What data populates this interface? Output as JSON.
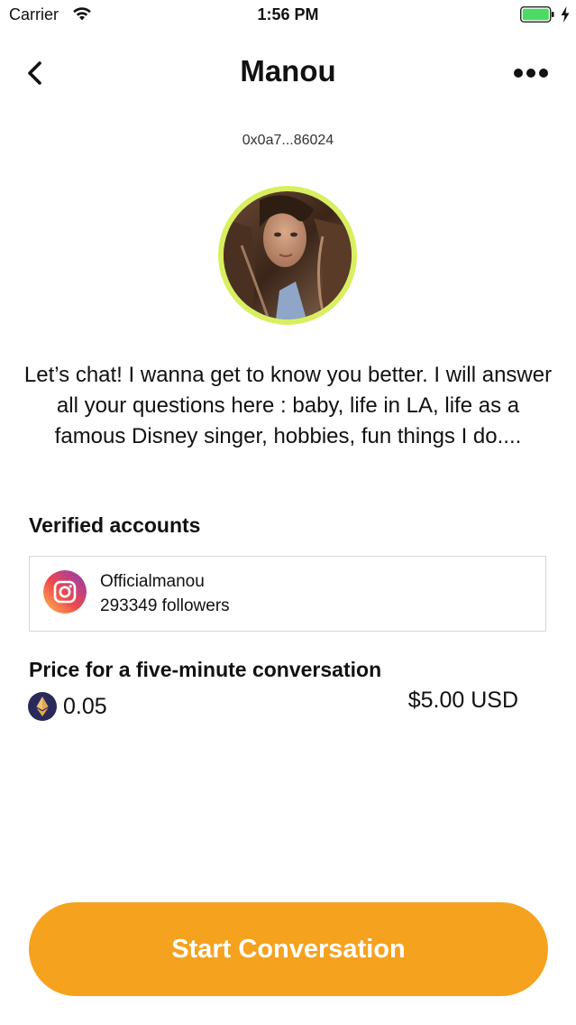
{
  "status_bar": {
    "carrier": "Carrier",
    "time": "1:56 PM",
    "battery_color": "#4cd964"
  },
  "header": {
    "title": "Manou",
    "back_icon": "chevron-left-icon",
    "more_icon": "more-horizontal-icon"
  },
  "profile": {
    "wallet_address": "0x0a7...86024",
    "avatar_ring_color": "#d9ef5f",
    "bio": "Let’s chat! I wanna get to know you better. I will answer all your questions here : baby, life in LA, life as a famous Disney singer, hobbies, fun things I do...."
  },
  "verified": {
    "section_title": "Verified accounts",
    "accounts": [
      {
        "platform_icon": "instagram-icon",
        "handle": "Officialmanou",
        "followers": "293349 followers"
      }
    ]
  },
  "price": {
    "section_title": "Price for a five-minute conversation",
    "currency_icon": "ethereum-icon",
    "eth_amount": "0.05",
    "usd_amount": "$5.00 USD"
  },
  "cta": {
    "label": "Start Conversation",
    "color": "#f5a21f"
  }
}
